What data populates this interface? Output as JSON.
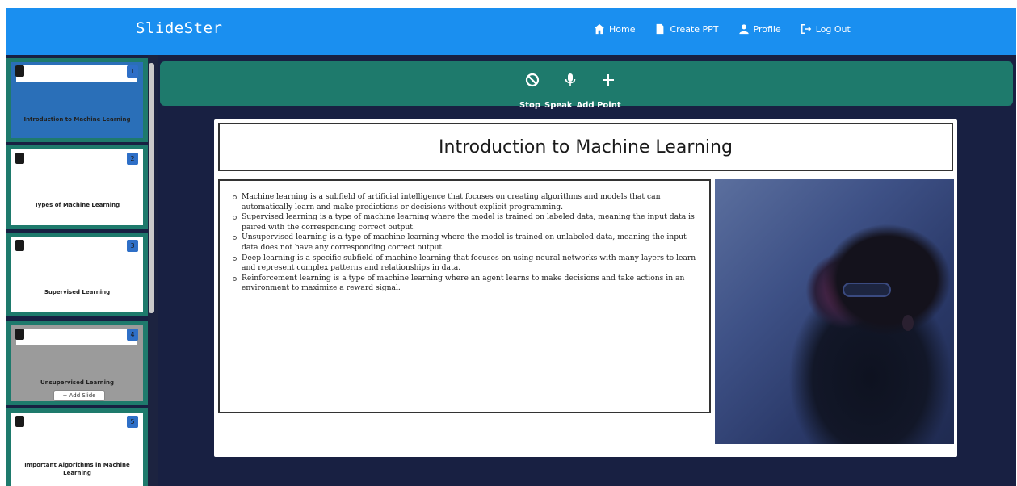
{
  "navbar": {
    "brand": "SlideSter",
    "links": [
      {
        "label": "Home",
        "icon": "home-icon"
      },
      {
        "label": "Create PPT",
        "icon": "file-icon"
      },
      {
        "label": "Profile",
        "icon": "user-icon"
      },
      {
        "label": "Log Out",
        "icon": "logout-icon"
      }
    ]
  },
  "toolbar": {
    "stop_label": "Stop",
    "speak_label": "Speak",
    "add_point_label": "Add Point"
  },
  "sidebar": {
    "add_slide_label": "+ Add Slide",
    "slides": [
      {
        "number": "1",
        "label": "Introduction to Machine Learning"
      },
      {
        "number": "2",
        "label": "Types of Machine Learning"
      },
      {
        "number": "3",
        "label": "Supervised Learning"
      },
      {
        "number": "4",
        "label": "Unsupervised Learning"
      },
      {
        "number": "5",
        "label": "Important Algorithms in Machine Learning"
      }
    ]
  },
  "slide": {
    "title": "Introduction to Machine Learning",
    "bullets": [
      "Machine learning is a subfield of artificial intelligence that focuses on creating algorithms and models that can automatically learn and make predictions or decisions without explicit programming.",
      "Supervised learning is a type of machine learning where the model is trained on labeled data, meaning the input data is paired with the corresponding correct output.",
      "Unsupervised learning is a type of machine learning where the model is trained on unlabeled data, meaning the input data does not have any corresponding correct output.",
      "Deep learning is a specific subfield of machine learning that focuses on using neural networks with many layers to learn and represent complex patterns and relationships in data.",
      "Reinforcement learning is a type of machine learning where an agent learns to make decisions and take actions in an environment to maximize a reward signal."
    ]
  },
  "colors": {
    "navbar": "#1a8ff0",
    "stage": "#182042",
    "teal": "#1e7a6c",
    "selected_slide": "#2a6fb8",
    "hover_slide": "#9b9b9b",
    "thumb_bg": "#ffffff"
  }
}
